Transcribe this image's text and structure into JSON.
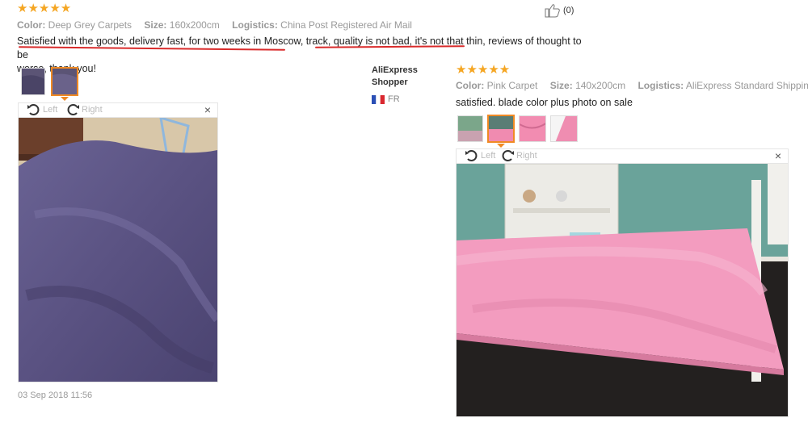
{
  "review1": {
    "stars": "★★★★★",
    "color_label": "Color:",
    "color_value": "Deep Grey Carpets",
    "size_label": "Size:",
    "size_value": "160x200cm",
    "logistics_label": "Logistics:",
    "logistics_value": "China Post Registered Air Mail",
    "text_line1": "Satisfied with the goods, delivery fast, for two weeks in Moscow, track, quality is not bad, it's not that thin, reviews of thought to be",
    "text_line2": "worse, thank you!",
    "helpful_count": "(0)",
    "viewer": {
      "left_label": "Left",
      "right_label": "Right",
      "close": "×"
    },
    "date": "03 Sep 2018 11:56"
  },
  "review2": {
    "user_name_line1": "AliExpress",
    "user_name_line2": "Shopper",
    "country": "FR",
    "stars": "★★★★★",
    "color_label": "Color:",
    "color_value": "Pink Carpet",
    "size_label": "Size:",
    "size_value": "140x200cm",
    "logistics_label": "Logistics:",
    "logistics_value": "AliExpress Standard Shipping",
    "text": "satisfied. blade color plus photo on sale",
    "viewer": {
      "left_label": "Left",
      "right_label": "Right",
      "close": "×"
    }
  },
  "colors": {
    "star": "#f5a623",
    "selected_thumb": "#f08a24",
    "underline": "#d92b2b"
  }
}
